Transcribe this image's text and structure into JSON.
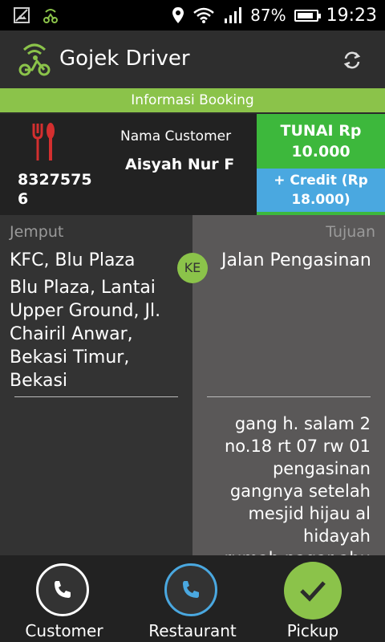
{
  "status_bar": {
    "battery": "87%",
    "time": "19:23",
    "battery_level": 0.87
  },
  "app": {
    "title": "Gojek Driver"
  },
  "info_bar": {
    "label": "Informasi Booking"
  },
  "booking": {
    "order_id": "83275756",
    "customer_label": "Nama Customer",
    "customer_name": "Aisyah Nur F",
    "cash_label": "TUNAI Rp 10.000",
    "credit_label": "+ Credit (Rp 18.000)"
  },
  "pickup": {
    "header": "Jemput",
    "name": "KFC, Blu Plaza",
    "address": "Blu Plaza, Lantai Upper Ground, Jl. Chairil Anwar, Bekasi Timur, Bekasi"
  },
  "separator": {
    "label": "KE"
  },
  "destination": {
    "header": "Tujuan",
    "name": "Jalan Pengasinan",
    "note": "gang h. salam 2\nno.18 rt 07 rw 01\npengasinan\ngangnya setelah\nmesjid hijau al\nhidayah\nrumah pagar abu"
  },
  "actions": {
    "customer": "Customer",
    "restaurant": "Restaurant",
    "pickup": "Pickup"
  },
  "colors": {
    "accent_green": "#8bc34a",
    "cash_green": "#3db83c",
    "credit_blue": "#4aa8e0",
    "food_red": "#d32f2f"
  }
}
